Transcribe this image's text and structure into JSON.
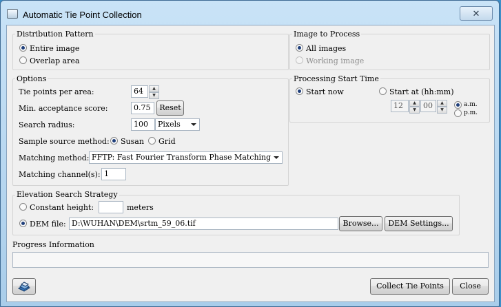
{
  "window": {
    "title": "Automatic Tie Point Collection",
    "close_glyph": "✕"
  },
  "distribution": {
    "title": "Distribution Pattern",
    "entire": "Entire image",
    "overlap": "Overlap area"
  },
  "image_to_process": {
    "title": "Image to Process",
    "all": "All images",
    "working": "Working image"
  },
  "options": {
    "title": "Options",
    "tie_points_label": "Tie points per area:",
    "tie_points_value": "64",
    "min_accept_label": "Min. acceptance score:",
    "min_accept_value": "0.75",
    "reset_label": "Reset",
    "search_radius_label": "Search radius:",
    "search_radius_value": "100",
    "search_radius_unit": "Pixels",
    "sample_source_label": "Sample source method:",
    "susan": "Susan",
    "grid": "Grid",
    "matching_method_label": "Matching method:",
    "matching_method_value": "FFTP: Fast Fourier Transform Phase Matching",
    "matching_channel_label": "Matching channel(s):",
    "matching_channel_value": "1"
  },
  "processing": {
    "title": "Processing Start Time",
    "start_now": "Start now",
    "start_at": "Start at (hh:mm)",
    "hour": "12",
    "minute": "00",
    "am": "a.m.",
    "pm": "p.m."
  },
  "elevation": {
    "title": "Elevation Search Strategy",
    "constant_height": "Constant height:",
    "constant_value": "",
    "meters": "meters",
    "dem_file": "DEM file:",
    "dem_path": "D:\\WUHAN\\DEM\\srtm_59_06.tif",
    "browse": "Browse...",
    "dem_settings": "DEM Settings..."
  },
  "progress": {
    "title": "Progress Information",
    "text": ""
  },
  "footer": {
    "collect_label": "Collect Tie Points",
    "close_label": "Close"
  }
}
